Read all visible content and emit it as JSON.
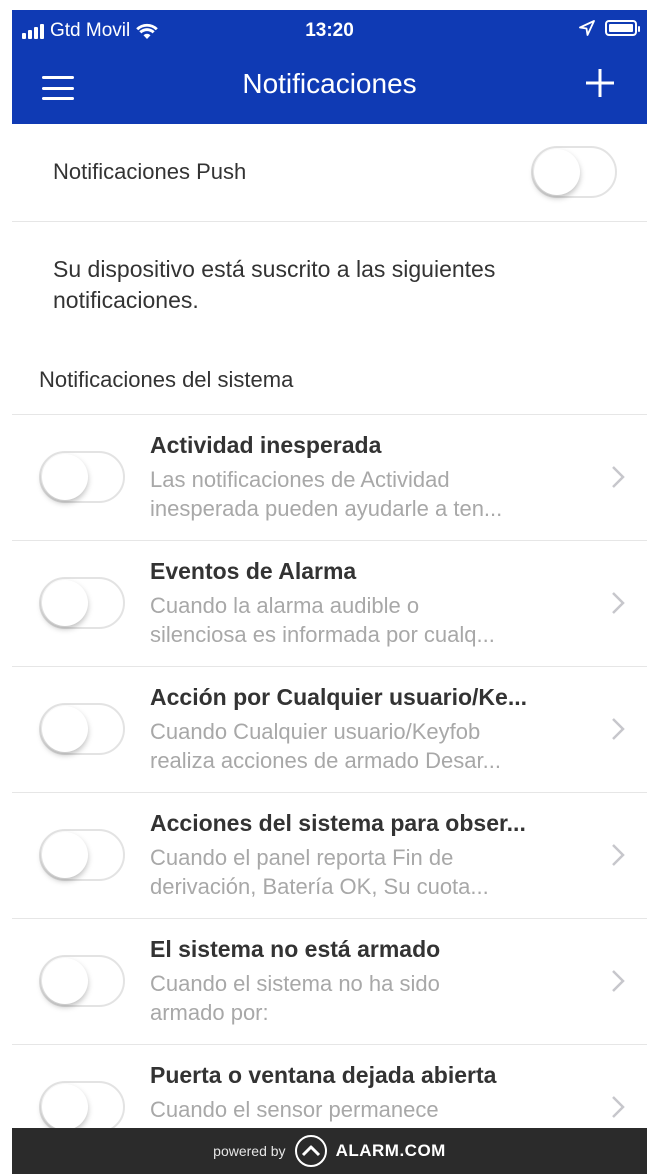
{
  "status_bar": {
    "carrier": "Gtd Movil",
    "time": "13:20",
    "icons": [
      "signal-icon",
      "wifi-icon",
      "location-arrow-icon",
      "battery-icon"
    ]
  },
  "header": {
    "title": "Notificaciones",
    "menu_icon": "hamburger-menu-icon",
    "add_icon": "plus-icon",
    "color": "#0f3ab4"
  },
  "push": {
    "label": "Notificaciones Push",
    "enabled": false
  },
  "intro_text": "Su dispositivo está suscrito a las siguientes notificaciones.",
  "section_title": "Notificaciones del sistema",
  "items": [
    {
      "title": "Actividad inesperada",
      "desc_l1": "Las notificaciones de Actividad",
      "desc_l2": "inesperada pueden ayudarle a ten...",
      "enabled": false
    },
    {
      "title": "Eventos de Alarma",
      "desc_l1": "Cuando la alarma audible o",
      "desc_l2": "silenciosa es informada por cualq...",
      "enabled": false
    },
    {
      "title": "Acción por Cualquier usuario/Ke...",
      "desc_l1": "Cuando Cualquier usuario/Keyfob",
      "desc_l2": "realiza acciones de armado Desar...",
      "enabled": false
    },
    {
      "title": "Acciones del sistema para obser...",
      "desc_l1": "Cuando el panel reporta Fin de",
      "desc_l2": "derivación, Batería OK, Su cuota...",
      "enabled": false
    },
    {
      "title": "El sistema no está armado",
      "desc_l1": "Cuando el sistema no ha sido",
      "desc_l2": "armado por:",
      "enabled": false
    },
    {
      "title": "Puerta o ventana dejada abierta",
      "desc_l1": "Cuando el sensor permanece",
      "desc_l2": "",
      "enabled": false
    }
  ],
  "footer": {
    "powered_by": "powered by",
    "brand": "ALARM.COM",
    "logo_icon": "alarm-com-logo-icon"
  }
}
